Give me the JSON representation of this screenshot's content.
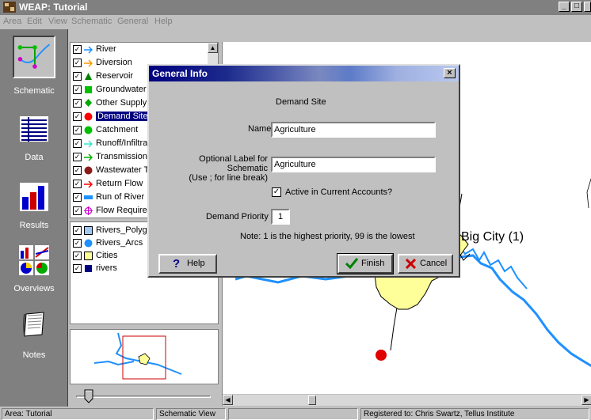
{
  "window": {
    "title": "WEAP: Tutorial",
    "minimize": "_",
    "maximize": "□"
  },
  "menu": [
    "Area",
    "Edit",
    "View",
    "Schematic",
    "General",
    "Help"
  ],
  "toolbar": {
    "schematic": "Schematic",
    "data": "Data",
    "results": "Results",
    "overviews": "Overviews",
    "notes": "Notes"
  },
  "legend": {
    "items": [
      {
        "label": "River",
        "icon": "river-arrow-icon",
        "color": "#1e90ff"
      },
      {
        "label": "Diversion",
        "icon": "diversion-arrow-icon",
        "color": "#ff9900"
      },
      {
        "label": "Reservoir",
        "icon": "reservoir-triangle-icon",
        "color": "#008000"
      },
      {
        "label": "Groundwater",
        "icon": "groundwater-square-icon",
        "color": "#00c000"
      },
      {
        "label": "Other Supply",
        "icon": "other-supply-diamond-icon",
        "color": "#00aa00"
      },
      {
        "label": "Demand Site",
        "icon": "demand-site-dot-icon",
        "color": "#ff0000"
      },
      {
        "label": "Catchment",
        "icon": "catchment-dot-icon",
        "color": "#00c000"
      },
      {
        "label": "Runoff/Infiltrat",
        "icon": "runoff-arrow-icon",
        "color": "#40e0d0"
      },
      {
        "label": "Transmission L",
        "icon": "transmission-arrow-icon",
        "color": "#00b000"
      },
      {
        "label": "Wastewater T",
        "icon": "wastewater-dot-icon",
        "color": "#8b1a1a"
      },
      {
        "label": "Return Flow",
        "icon": "return-flow-arrow-icon",
        "color": "#ff0000"
      },
      {
        "label": "Run of River H",
        "icon": "run-of-river-bar-icon",
        "color": "#1e90ff"
      },
      {
        "label": "Flow Requirem",
        "icon": "flow-requirement-icon",
        "color": "#cc00cc"
      }
    ],
    "layers": [
      {
        "label": "Rivers_Polygo",
        "icon": "polygon-layer-icon",
        "color": "#a0c8f0"
      },
      {
        "label": "Rivers_Arcs",
        "icon": "arcs-layer-icon",
        "color": "#1e90ff"
      },
      {
        "label": "Cities",
        "icon": "cities-layer-icon",
        "color": "#ffff99"
      },
      {
        "label": "rivers",
        "icon": "rivers-layer-icon",
        "color": "#000080"
      }
    ]
  },
  "map": {
    "city_label": "Big City (1)"
  },
  "dialog": {
    "title": "General Info",
    "close": "×",
    "heading": "Demand Site",
    "name_label": "Name",
    "name_value": "Agriculture",
    "optional_label_line1": "Optional Label for Schematic",
    "optional_label_line2": "(Use ; for line break)",
    "optional_value": "Agriculture",
    "active_label": "Active in Current Accounts?",
    "active_checked": "✓",
    "priority_label": "Demand Priority",
    "priority_value": "1",
    "note": "Note: 1 is the highest priority, 99 is the lowest",
    "help_label": "Help",
    "finish_label": "Finish",
    "cancel_label": "Cancel"
  },
  "status": {
    "area": "Area: Tutorial",
    "view": "Schematic View",
    "registered": "Registered to: Chris Swartz, Tellus Institute"
  }
}
